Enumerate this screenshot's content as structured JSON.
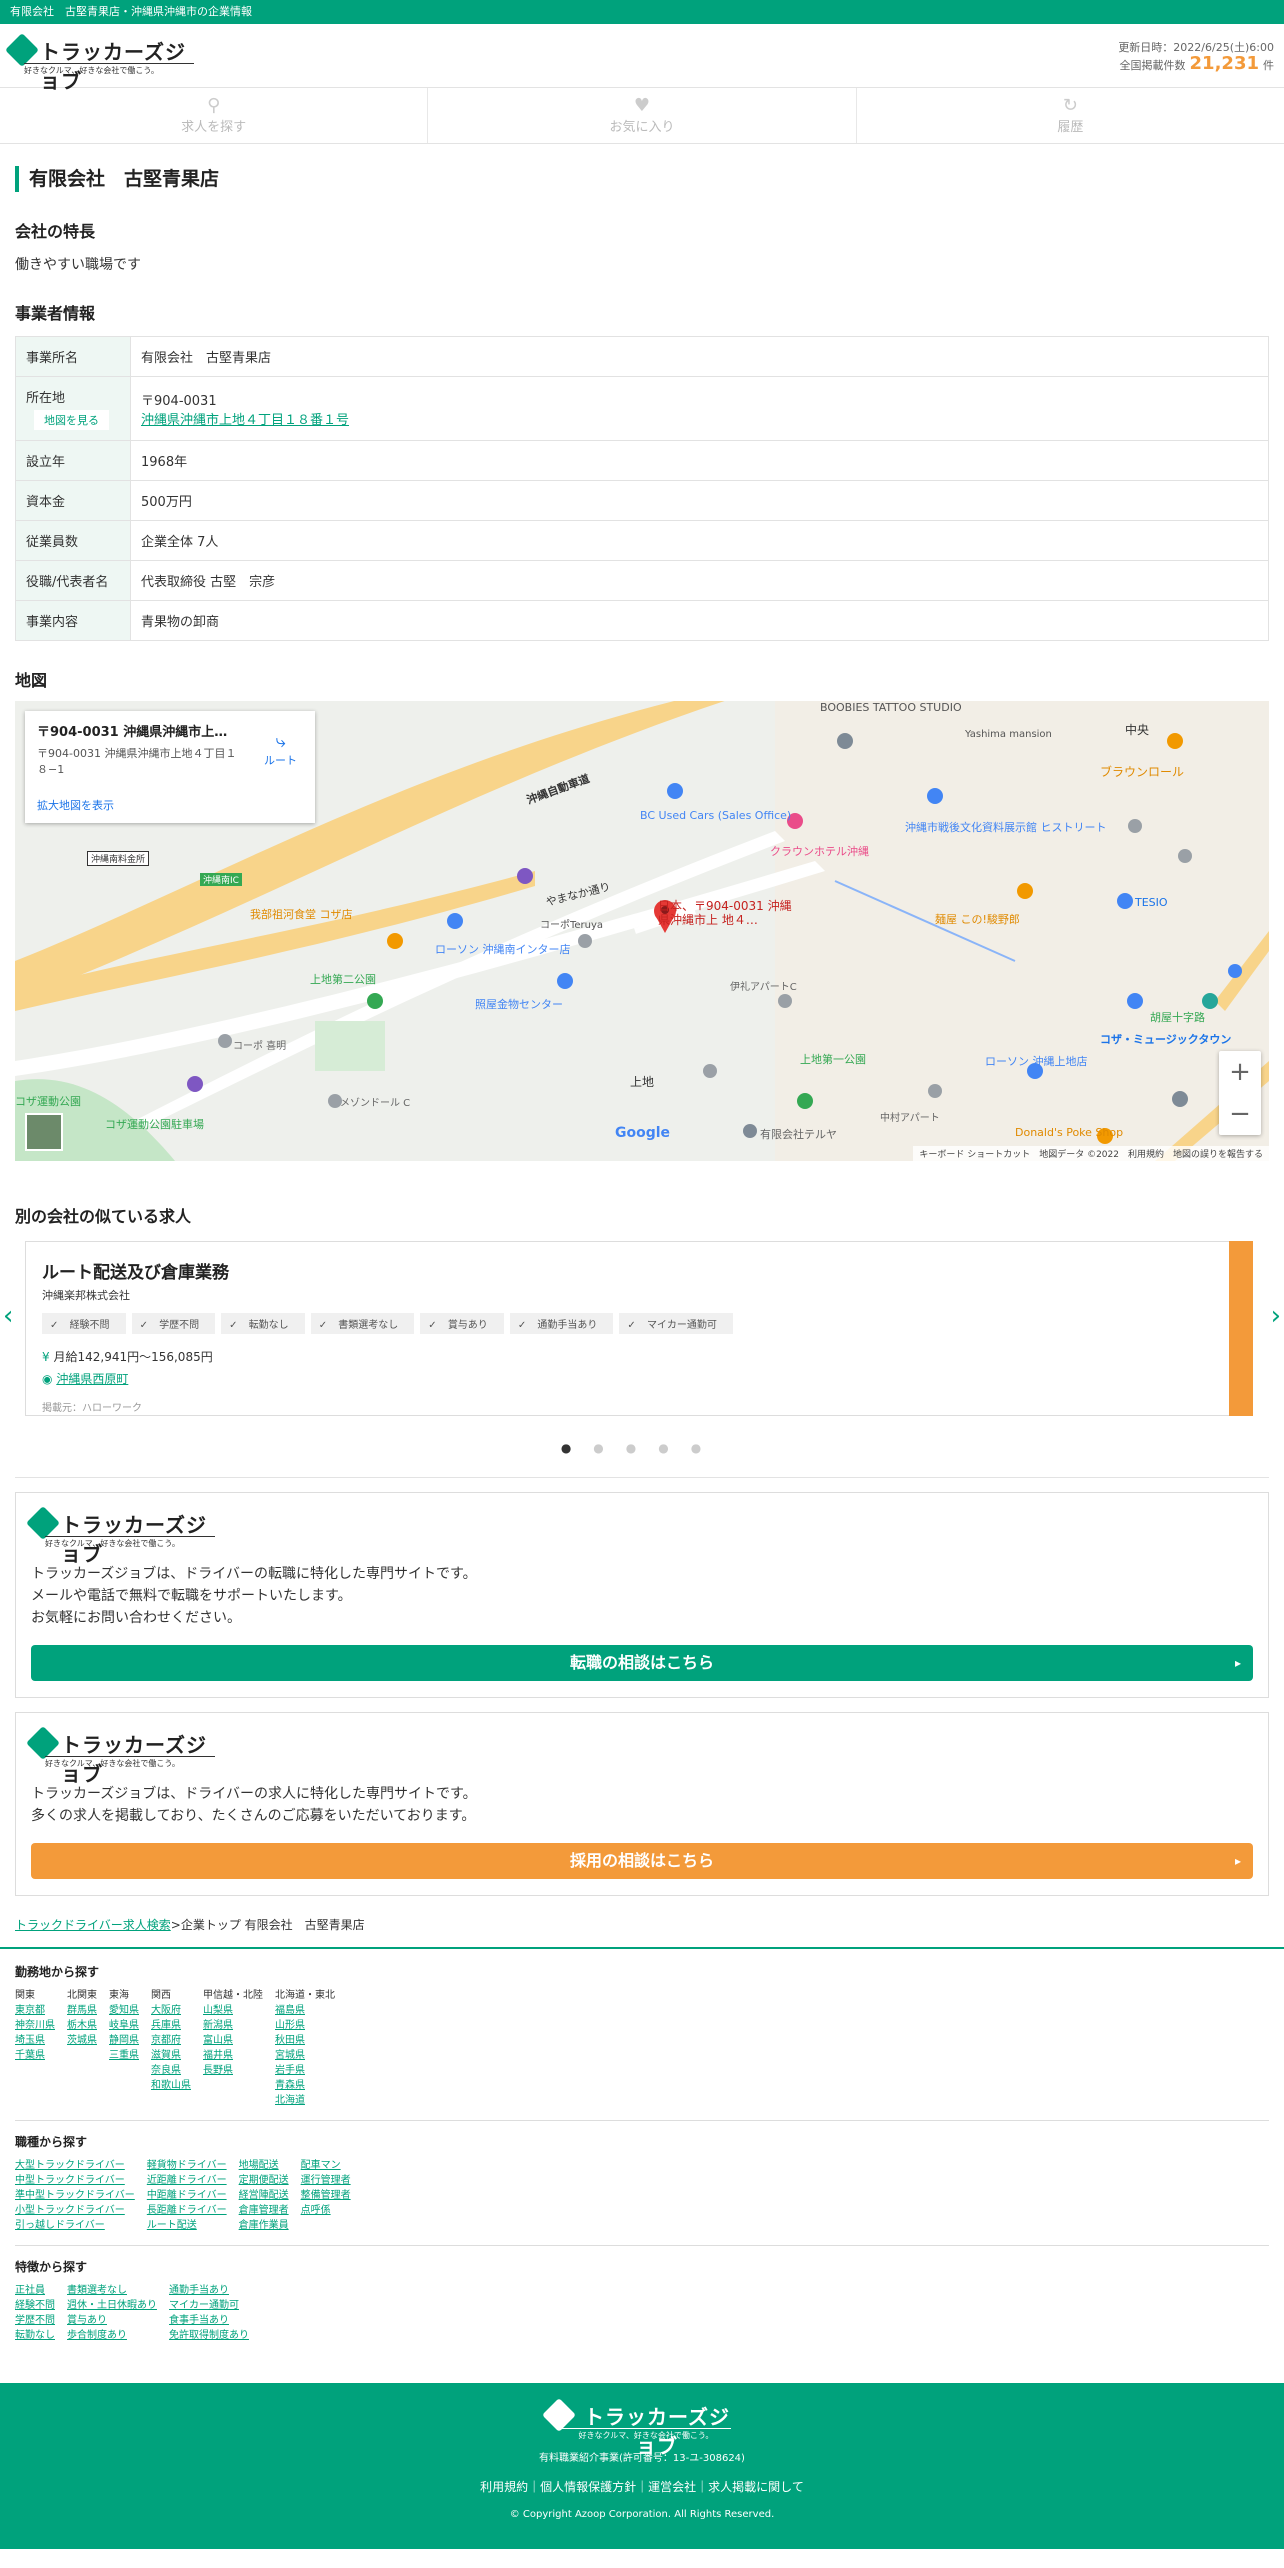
{
  "topbar": {
    "text": "有限会社　古堅青果店・沖縄県沖縄市の企業情報"
  },
  "header": {
    "logo_name": "トラッカーズジョブ",
    "logo_tagline": "好きなクルマ、好きな会社で働こう。",
    "updated": "更新日時：2022/6/25(土)6:00",
    "total_label": "全国掲載件数",
    "total_count": "21,231",
    "total_unit": "件"
  },
  "nav": [
    {
      "label": "求人を探す",
      "icon": "search-icon"
    },
    {
      "label": "お気に入り",
      "icon": "heart-icon"
    },
    {
      "label": "履歴",
      "icon": "history-icon"
    }
  ],
  "company": {
    "name": "有限会社　古堅青果店",
    "features_heading": "会社の特長",
    "features_text": "働きやすい職場です",
    "info_heading": "事業者情報",
    "rows": [
      {
        "label": "事業所名",
        "value": "有限会社　古堅青果店"
      },
      {
        "label": "所在地",
        "value_zip": "〒904-0031",
        "value_addr": "沖縄県沖縄市上地４丁目１８番１号",
        "map_btn": "地図を見る"
      },
      {
        "label": "設立年",
        "value": "1968年"
      },
      {
        "label": "資本金",
        "value": "500万円"
      },
      {
        "label": "従業員数",
        "value": "企業全体 7人"
      },
      {
        "label": "役職/代表者名",
        "value": "代表取締役 古堅　宗彦"
      },
      {
        "label": "事業内容",
        "value": "青果物の卸商"
      }
    ]
  },
  "map": {
    "heading": "地図",
    "card_title": "〒904-0031 沖縄県沖縄市上地...",
    "card_addr": "〒904-0031 沖縄県沖縄市上地４丁目１８−1",
    "card_link": "拡大地図を表示",
    "card_route": "ルート",
    "pin_label": "日本、〒904-0031 沖縄県沖縄市上 地４…",
    "google": "Google",
    "attribution": "キーボード ショートカット　地図データ ©2022　利用規約　地図の誤りを報告する",
    "places": [
      "BOOBIES TATTOO STUDIO",
      "中央",
      "ブラウンロール",
      "BC Used Cars (Sales Office)",
      "沖縄自動車道",
      "クラウンホテル沖縄",
      "沖縄市戦後文化資料展示館 ヒストリート",
      "やまなか通り",
      "我部祖河食堂 コザ店",
      "ローソン 沖縄南インター店",
      "上地第二公園",
      "照屋金物センター",
      "上地",
      "上地第一公園",
      "ローソン 沖縄上地店",
      "コザ・ミュージックタウン",
      "麺屋 この!駿野郎",
      "胡屋十字路",
      "コザ運動公園",
      "コザ運動公園駐車場",
      "有限会社テルヤ",
      "Donald's Poke Shop",
      "沖縄南IC",
      "沖縄南料金所",
      "メゾンドール C",
      "コーポ 喜明",
      "伊礼アパートC",
      "中村アパート",
      "TESIO",
      "コーポTeruya",
      "Yashima mansion"
    ]
  },
  "similar": {
    "heading": "別の会社の似ている求人",
    "job_title": "ルート配送及び倉庫業務",
    "job_company": "沖縄楽邦株式会社",
    "tags": [
      "経験不問",
      "学歴不問",
      "転勤なし",
      "書類選考なし",
      "賞与あり",
      "通勤手当あり",
      "マイカー通勤可"
    ],
    "salary": "月給142,941円〜156,085円",
    "location": "沖縄県西原町",
    "source": "掲載元：ハローワーク"
  },
  "promo1": {
    "text1": "トラッカーズジョブは、ドライバーの転職に特化した専門サイトです。",
    "text2": "メールや電話で無料で転職をサポートいたします。",
    "text3": "お気軽にお問い合わせください。",
    "button": "転職の相談はこちら"
  },
  "promo2": {
    "text1": "トラッカーズジョブは、ドライバーの求人に特化した専門サイトです。",
    "text2": "多くの求人を掲載しており、たくさんのご応募をいただいております。",
    "button": "採用の相談はこちら"
  },
  "breadcrumb": {
    "link": "トラックドライバー求人検索",
    "current": ">企業トップ 有限会社　古堅青果店"
  },
  "area": {
    "heading": "勤務地から探す",
    "cols": [
      {
        "head": "関東",
        "items": [
          "東京都",
          "神奈川県",
          "埼玉県",
          "千葉県"
        ]
      },
      {
        "head": "北関東",
        "items": [
          "群馬県",
          "栃木県",
          "茨城県"
        ]
      },
      {
        "head": "東海",
        "items": [
          "愛知県",
          "岐阜県",
          "静岡県",
          "三重県"
        ]
      },
      {
        "head": "関西",
        "items": [
          "大阪府",
          "兵庫県",
          "京都府",
          "滋賀県",
          "奈良県",
          "和歌山県"
        ]
      },
      {
        "head": "甲信越・北陸",
        "items": [
          "山梨県",
          "新潟県",
          "富山県",
          "福井県",
          "長野県"
        ]
      },
      {
        "head": "北海道・東北",
        "items": [
          "福島県",
          "山形県",
          "秋田県",
          "宮城県",
          "岩手県",
          "青森県",
          "北海道"
        ]
      }
    ]
  },
  "job_types": {
    "heading": "職種から探す",
    "cols": [
      [
        "大型トラックドライバー",
        "中型トラックドライバー",
        "準中型トラックドライバー",
        "小型トラックドライバー",
        "引っ越しドライバー"
      ],
      [
        "軽貨物ドライバー",
        "近距離ドライバー",
        "中距離ドライバー",
        "長距離ドライバー",
        "ルート配送"
      ],
      [
        "地場配送",
        "定期便配送",
        "経営陣配送",
        "倉庫管理者",
        "倉庫作業員"
      ],
      [
        "配車マン",
        "運行管理者",
        "整備管理者",
        "点呼係"
      ]
    ]
  },
  "features": {
    "heading": "特徴から探す",
    "cols": [
      [
        "正社員",
        "経験不問",
        "学歴不問",
        "転勤なし"
      ],
      [
        "書類選考なし",
        "週休・土日休暇あり",
        "賞与あり",
        "歩合制度あり"
      ],
      [
        "通勤手当あり",
        "マイカー通勤可",
        "食事手当あり",
        "免許取得制度あり"
      ]
    ]
  },
  "footer": {
    "license": "有料職業紹介事業(許可番号：13-ユ-308624)",
    "nav": "利用規約｜個人情報保護方針｜運営会社｜求人掲載に関して",
    "copyright": "© Copyright Azoop Corporation. All Rights Reserved.",
    "logo_name": "トラッカーズジョブ",
    "logo_tagline": "好きなクルマ、好きな会社で働こう。"
  },
  "colors": {
    "brand": "#00a27c",
    "accent": "#f39a3a"
  }
}
